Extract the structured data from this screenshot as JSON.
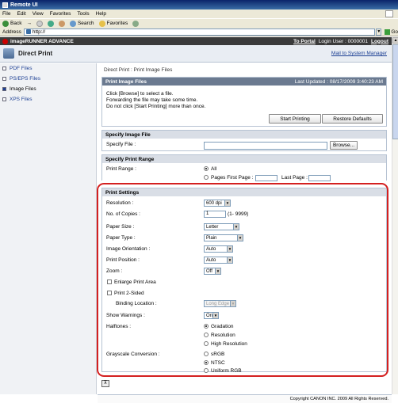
{
  "window": {
    "title": "Remote UI"
  },
  "menu": [
    "File",
    "Edit",
    "View",
    "Favorites",
    "Tools",
    "Help"
  ],
  "toolbar": {
    "back": "Back",
    "forward": "→",
    "search": "Search",
    "favorites": "Favorites"
  },
  "address": {
    "label": "Address",
    "value": "http://",
    "go": "Go"
  },
  "header": {
    "brand": "imageRUNNER ADVANCE",
    "to_portal": "To Portal",
    "login_user": "Login User : 0000001",
    "logout": "Logout",
    "title": "Direct Print",
    "mail": "Mail to System Manager"
  },
  "sidebar": {
    "items": [
      {
        "label": "PDF Files"
      },
      {
        "label": "PS/EPS Files"
      },
      {
        "label": "Image Files"
      },
      {
        "label": "XPS Files"
      }
    ]
  },
  "breadcrumb": "Direct Print : Print Image Files",
  "print_image": {
    "title": "Print Image Files",
    "updated": "Last Updated : 08/17/2009 3:40:23 AM",
    "lines": [
      "Click [Browse] to select a file.",
      "Forwarding the file may take some time.",
      "Do not click [Start Printing] more than once."
    ],
    "start": "Start Printing",
    "restore": "Restore Defaults"
  },
  "specify_file": {
    "title": "Specify Image File",
    "label": "Specify File :",
    "browse": "Browse..."
  },
  "print_range": {
    "title": "Specify Print Range",
    "label": "Print Range :",
    "all": "All",
    "pages": "Pages First Page :",
    "last": "Last Page :"
  },
  "settings": {
    "title": "Print Settings",
    "resolution": {
      "label": "Resolution :",
      "value": "600 dpi"
    },
    "copies": {
      "label": "No. of Copies :",
      "value": "1",
      "hint": "(1- 9999)"
    },
    "paper_size": {
      "label": "Paper Size :",
      "value": "Letter"
    },
    "paper_type": {
      "label": "Paper Type :",
      "value": "Plain"
    },
    "orientation": {
      "label": "Image Orientation :",
      "value": "Auto"
    },
    "position": {
      "label": "Print Position :",
      "value": "Auto"
    },
    "zoom": {
      "label": "Zoom :",
      "value": "Off"
    },
    "enlarge": "Enlarge Print Area",
    "two_sided": "Print 2-Sided",
    "binding": {
      "label": "Binding Location :",
      "value": "Long Edge"
    },
    "warnings": {
      "label": "Show Warnings :",
      "value": "On"
    },
    "halftones": {
      "label": "Halftones :",
      "options": [
        "Gradation",
        "Resolution",
        "High Resolution"
      ]
    },
    "grayscale": {
      "label": "Grayscale Conversion :",
      "options": [
        "sRGB",
        "NTSC",
        "Uniform RGB"
      ]
    }
  },
  "footer": "Copyright CANON INC. 2009 All Rights Reserved."
}
